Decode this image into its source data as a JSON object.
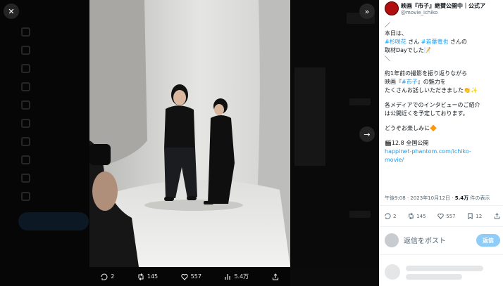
{
  "post": {
    "name": "映画『市子』絶賛公開中｜公式ア",
    "handle": "@movie_ichiko",
    "lines": [
      {
        "kind": "text",
        "text": "／"
      },
      {
        "kind": "text",
        "text": "本日は、"
      },
      {
        "kind": "mixed",
        "parts": [
          {
            "t": "#杉咲花",
            "c": "tag"
          },
          {
            "t": " さん ",
            "c": ""
          },
          {
            "t": "#若葉竜也",
            "c": "tag"
          },
          {
            "t": " さんの",
            "c": ""
          }
        ]
      },
      {
        "kind": "text",
        "text": "取材Dayでした📝"
      },
      {
        "kind": "text",
        "text": "＼"
      },
      {
        "kind": "gap"
      },
      {
        "kind": "text",
        "text": "約1年前の撮影を振り返りながら"
      },
      {
        "kind": "mixed",
        "parts": [
          {
            "t": "映画『",
            "c": ""
          },
          {
            "t": "#市子",
            "c": "tag"
          },
          {
            "t": "』の魅力を",
            "c": ""
          }
        ]
      },
      {
        "kind": "text",
        "text": "たくさんお話しいただきました👏✨"
      },
      {
        "kind": "gap"
      },
      {
        "kind": "text",
        "text": "各メディアでのインタビューのご紹介"
      },
      {
        "kind": "text",
        "text": "は公開近くを予定しております。"
      },
      {
        "kind": "gap"
      },
      {
        "kind": "text",
        "text": "どうぞお楽しみに🔶"
      },
      {
        "kind": "gap"
      },
      {
        "kind": "text",
        "text": "🎬12.8 全国公開"
      },
      {
        "kind": "link",
        "text": "happinet-phantom.com/ichiko-"
      },
      {
        "kind": "link",
        "text": "movie/"
      }
    ],
    "meta_time": "午後9:08 · 2023年10月12日 · ",
    "meta_views": "5.4万",
    "meta_views_suffix": " 件の表示",
    "actions": {
      "replies": "2",
      "reposts": "145",
      "likes": "557",
      "bookmarks": "12"
    },
    "reply_placeholder": "返信をポスト",
    "reply_button": "返信"
  },
  "media_bar": {
    "replies": "2",
    "reposts": "145",
    "likes": "557",
    "views": "5.4万"
  },
  "colors": {
    "accent": "#1d9bf0",
    "avatar": "#b00f0f",
    "overlay": "#060606"
  },
  "icons": [
    "close-icon",
    "expand-icon",
    "next-arrow-icon",
    "reply-icon",
    "repost-icon",
    "like-icon",
    "views-icon",
    "share-icon",
    "bookmark-icon",
    "more-icon"
  ]
}
